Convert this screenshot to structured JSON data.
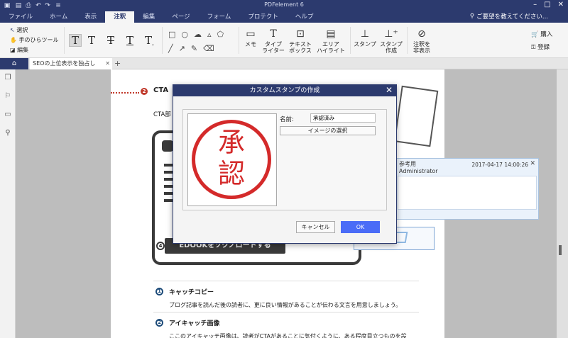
{
  "app": {
    "title": "PDFelement 6"
  },
  "menu": {
    "items": [
      "ファイル",
      "ホーム",
      "表示",
      "注釈",
      "編集",
      "ページ",
      "フォーム",
      "プロテクト",
      "ヘルプ"
    ],
    "active_index": 3,
    "help_placeholder": "ご要望を教えてください..."
  },
  "ribbon": {
    "select_label": "選択",
    "hand_label": "手のひらツール",
    "edit_label": "編集",
    "memo_label": "メモ",
    "typewriter_label": "タイプ\nライター",
    "textbox_label": "テキスト\nボックス",
    "area_highlight_label": "エリア\nハイライト",
    "stamp_label": "スタンプ",
    "create_stamp_label": "スタンプ\n作成",
    "hide_annot_label": "注釈を\n非表示",
    "buy_label": "購入",
    "register_label": "登録"
  },
  "tabs": {
    "doc_tab_label": "SEOの上位表示を独占し"
  },
  "document": {
    "heading": "CTA",
    "subtext": "CTA部",
    "ebook_button": "EDOOKをソクノロードする",
    "item1_title": "キャッチコピー",
    "item1_body": "ブログ記事を読んだ後の読者に、更に良い情報があることが伝わる文言を用意しましょう。",
    "item2_title": "アイキャッチ画像",
    "item2_body": "ここのアイキャッチ画像は、読者がCTAがあることに気付くように、ある程度目立つものを設"
  },
  "dialog": {
    "title": "カスタムスタンプの作成",
    "name_label": "名前:",
    "name_value": "承認済み",
    "image_select_label": "イメージの選択",
    "stamp_char1": "承",
    "stamp_char2": "認",
    "cancel_label": "キャンセル",
    "ok_label": "OK"
  },
  "note": {
    "title": "参考用",
    "author": "Administrator",
    "timestamp": "2017-04-17 14:00:26"
  },
  "colors": {
    "titlebar": "#2c3a6e",
    "accent_blue": "#4a6cf7",
    "stamp_red": "#d42a2a",
    "dot_red": "#c0392b"
  }
}
